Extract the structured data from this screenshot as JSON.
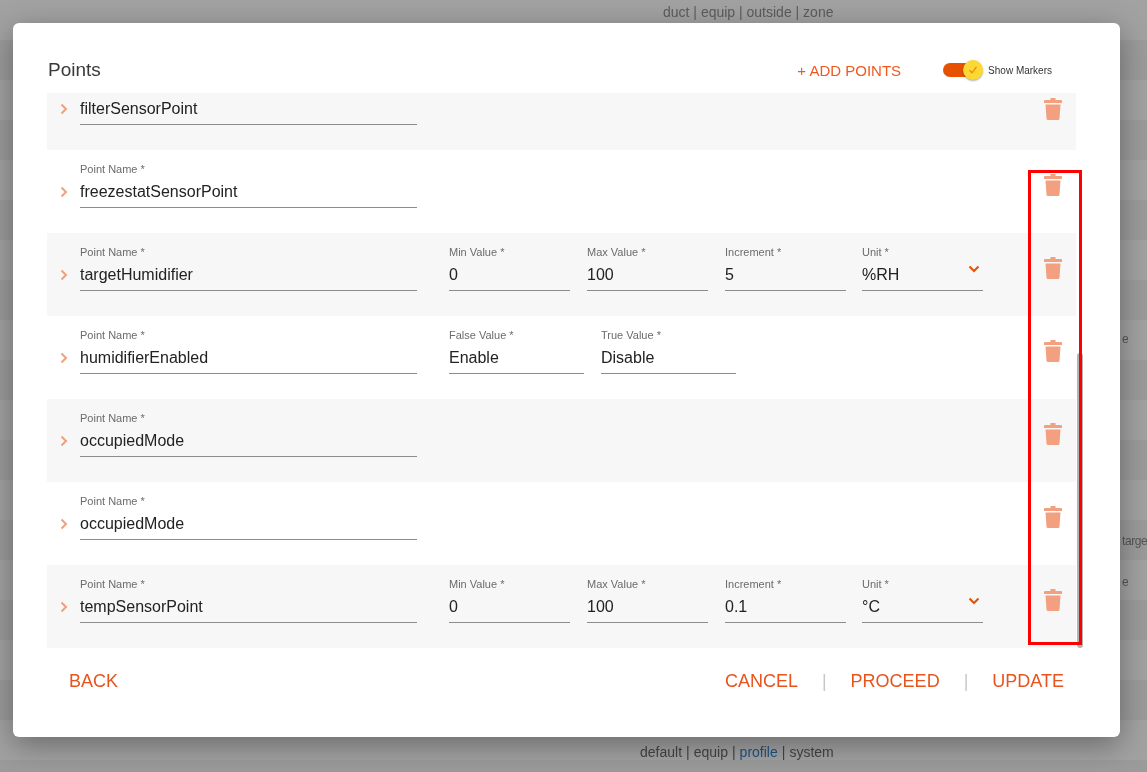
{
  "background": {
    "top_text": "duct | equip | outside | zone",
    "side_fragments": [
      "e",
      "targe",
      "e"
    ],
    "bottom_parts": [
      {
        "text": "default",
        "kind": "plain"
      },
      {
        "text": "|",
        "kind": "separator"
      },
      {
        "text": "equip",
        "kind": "plain"
      },
      {
        "text": "|",
        "kind": "separator"
      },
      {
        "text": "profile",
        "kind": "link"
      },
      {
        "text": "|",
        "kind": "separator"
      },
      {
        "text": "system",
        "kind": "plain"
      }
    ]
  },
  "dialog": {
    "title": "Points",
    "add_button": "+ ADD POINTS",
    "markers_toggle": {
      "label": "Show Markers",
      "on": true
    },
    "rows": [
      {
        "kind": "name",
        "expanded": false,
        "fields": [
          {
            "kind": "text",
            "value": "filterSensorPoint"
          }
        ]
      },
      {
        "kind": "name",
        "expanded": false,
        "fields": [
          {
            "kind": "text",
            "label": "Point Name *",
            "value": "freezestatSensorPoint"
          }
        ]
      },
      {
        "kind": "range",
        "expanded": false,
        "fields": [
          {
            "kind": "text",
            "label": "Point Name *",
            "value": "targetHumidifier"
          },
          {
            "kind": "text",
            "label": "Min Value *",
            "value": "0"
          },
          {
            "kind": "text",
            "label": "Max Value *",
            "value": "100"
          },
          {
            "kind": "text",
            "label": "Increment *",
            "value": "5"
          },
          {
            "kind": "select",
            "label": "Unit *",
            "value": "%RH"
          }
        ]
      },
      {
        "kind": "boolean",
        "expanded": false,
        "fields": [
          {
            "kind": "text",
            "label": "Point Name *",
            "value": "humidifierEnabled"
          },
          {
            "kind": "text",
            "label": "False Value *",
            "value": "Enable"
          },
          {
            "kind": "text",
            "label": "True Value *",
            "value": "Disable"
          }
        ]
      },
      {
        "kind": "name",
        "expanded": false,
        "fields": [
          {
            "kind": "text",
            "label": "Point Name *",
            "value": "occupiedMode"
          }
        ]
      },
      {
        "kind": "name",
        "expanded": false,
        "fields": [
          {
            "kind": "text",
            "label": "Point Name *",
            "value": "occupiedMode"
          }
        ]
      },
      {
        "kind": "range",
        "expanded": false,
        "fields": [
          {
            "kind": "text",
            "label": "Point Name *",
            "value": "tempSensorPoint"
          },
          {
            "kind": "text",
            "label": "Min Value *",
            "value": "0"
          },
          {
            "kind": "text",
            "label": "Max Value *",
            "value": "100"
          },
          {
            "kind": "text",
            "label": "Increment *",
            "value": "0.1"
          },
          {
            "kind": "select",
            "label": "Unit *",
            "value": "°C"
          }
        ]
      }
    ],
    "annotation": {
      "kind": "frame"
    },
    "back_button": "BACK",
    "actions": [
      {
        "kind": "button",
        "text": "CANCEL"
      },
      {
        "kind": "separator",
        "text": "|"
      },
      {
        "kind": "button",
        "text": "PROCEED"
      },
      {
        "kind": "separator",
        "text": "|"
      },
      {
        "kind": "button",
        "text": "UPDATE"
      }
    ]
  }
}
